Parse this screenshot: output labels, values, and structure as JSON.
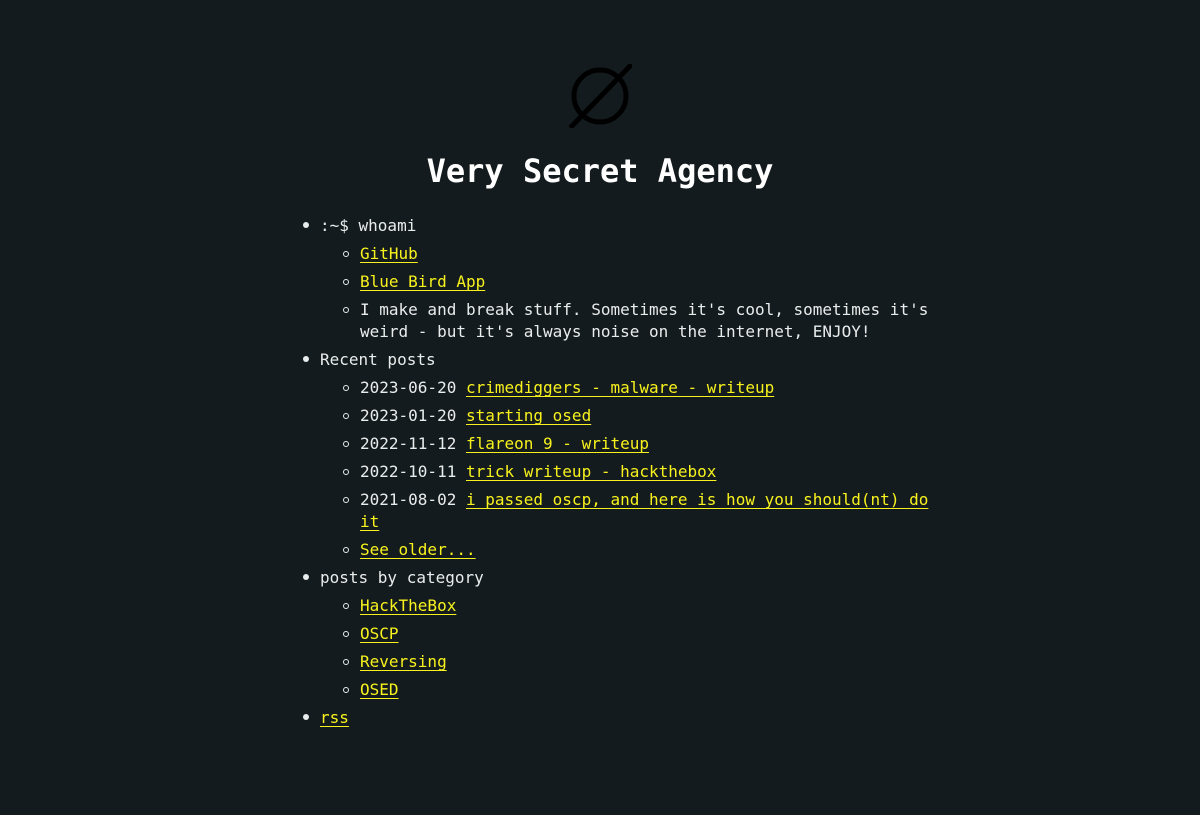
{
  "site": {
    "title": "Very Secret Agency"
  },
  "sections": {
    "whoami": {
      "label": ":~$ whoami",
      "github": "GitHub",
      "bluebird": "Blue Bird App",
      "bio": "I make and break stuff. Sometimes it's cool, sometimes it's weird - but it's always noise on the internet, ENJOY!"
    },
    "recent": {
      "label": "Recent posts",
      "posts": [
        {
          "date": "2023-06-20",
          "title": "crimediggers - malware - writeup"
        },
        {
          "date": "2023-01-20",
          "title": "starting osed"
        },
        {
          "date": "2022-11-12",
          "title": "flareon 9 - writeup"
        },
        {
          "date": "2022-10-11",
          "title": "trick writeup - hackthebox"
        },
        {
          "date": "2021-08-02",
          "title": "i passed oscp, and here is how you should(nt) do it"
        }
      ],
      "older": "See older..."
    },
    "categories": {
      "label": "posts by category",
      "items": [
        "HackTheBox",
        "OSCP",
        "Reversing",
        "OSED"
      ]
    },
    "rss": "rss"
  },
  "colors": {
    "background": "#141b1e",
    "text": "#e9ecec",
    "link": "#f7f21d",
    "logo": "#000000"
  },
  "icons": {
    "logo": "empty-set-icon"
  }
}
